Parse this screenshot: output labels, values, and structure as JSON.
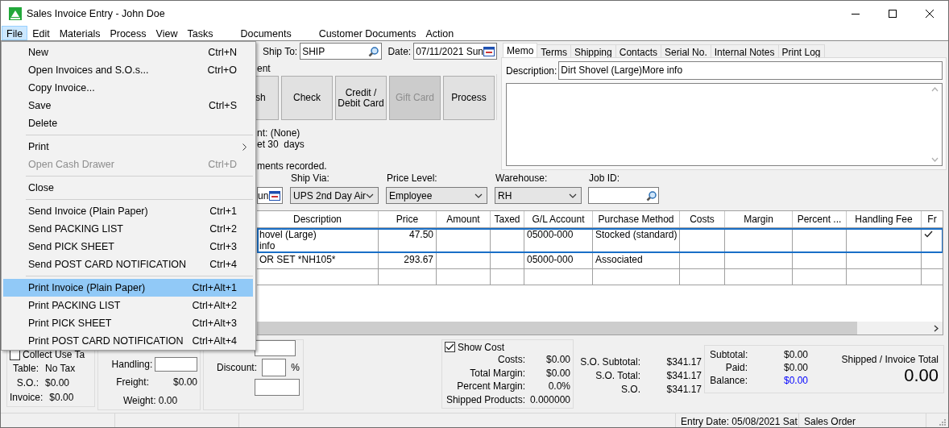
{
  "window": {
    "title": "Sales Invoice Entry - John Doe"
  },
  "menu_bar": [
    {
      "label": "File",
      "selected": true
    },
    {
      "label": "Edit",
      "selected": false
    },
    {
      "label": "Materials",
      "selected": false
    },
    {
      "label": "Process",
      "selected": false
    },
    {
      "label": "View",
      "selected": false
    },
    {
      "label": "Tasks",
      "selected": false
    },
    {
      "label": "Documents",
      "selected": false
    },
    {
      "label": "Customer Documents",
      "selected": false
    },
    {
      "label": "Action",
      "selected": false
    }
  ],
  "file_menu": [
    {
      "kind": "item",
      "label": "New",
      "shortcut": "Ctrl+N",
      "disabled": false,
      "selected": false
    },
    {
      "kind": "item",
      "label": "Open Invoices and S.O.s...",
      "shortcut": "Ctrl+O",
      "disabled": false,
      "selected": false
    },
    {
      "kind": "item",
      "label": "Copy Invoice...",
      "disabled": false,
      "selected": false
    },
    {
      "kind": "item",
      "label": "Save",
      "shortcut": "Ctrl+S",
      "disabled": false,
      "selected": false
    },
    {
      "kind": "item",
      "label": "Delete",
      "disabled": false,
      "selected": false
    },
    {
      "kind": "separator"
    },
    {
      "kind": "submenu",
      "label": "Print",
      "disabled": false,
      "selected": false
    },
    {
      "kind": "item",
      "label": "Open Cash Drawer",
      "shortcut": "Ctrl+D",
      "disabled": true,
      "selected": false
    },
    {
      "kind": "separator"
    },
    {
      "kind": "item",
      "label": "Close",
      "disabled": false,
      "selected": false
    },
    {
      "kind": "separator"
    },
    {
      "kind": "item",
      "label": "Send Invoice (Plain Paper)",
      "shortcut": "Ctrl+1",
      "disabled": false,
      "selected": false
    },
    {
      "kind": "item",
      "label": "Send PACKING LIST",
      "shortcut": "Ctrl+2",
      "disabled": false,
      "selected": false
    },
    {
      "kind": "item",
      "label": "Send PICK SHEET",
      "shortcut": "Ctrl+3",
      "disabled": false,
      "selected": false
    },
    {
      "kind": "item",
      "label": "Send POST CARD NOTIFICATION",
      "shortcut": "Ctrl+4",
      "disabled": false,
      "selected": false
    },
    {
      "kind": "separator"
    },
    {
      "kind": "item",
      "label": "Print Invoice (Plain Paper)",
      "shortcut": "Ctrl+Alt+1",
      "disabled": false,
      "selected": true
    },
    {
      "kind": "item",
      "label": "Print PACKING LIST",
      "shortcut": "Ctrl+Alt+2",
      "disabled": false,
      "selected": false
    },
    {
      "kind": "item",
      "label": "Print PICK SHEET",
      "shortcut": "Ctrl+Alt+3",
      "disabled": false,
      "selected": false
    },
    {
      "kind": "item",
      "label": "Print POST CARD NOTIFICATION",
      "shortcut": "Ctrl+Alt+4",
      "disabled": false,
      "selected": false
    }
  ],
  "ship_to": {
    "label": "Ship To:",
    "value": "SHIP"
  },
  "date": {
    "label": "Date:",
    "value": "07/11/2021 Sun"
  },
  "payment": {
    "label": "ent",
    "buttons": [
      {
        "label": "sh",
        "disabled": false
      },
      {
        "label": "Check",
        "disabled": false
      },
      {
        "label": "Credit /\nDebit Card",
        "disabled": false
      },
      {
        "label": "Gift Card",
        "disabled": true
      },
      {
        "label": "Process",
        "disabled": false
      }
    ],
    "info": [
      "nt: (None)",
      "et 30  days",
      "ments recorded."
    ]
  },
  "tabs": [
    {
      "label": "Memo",
      "selected": true
    },
    {
      "label": "Terms",
      "selected": false
    },
    {
      "label": "Shipping",
      "selected": false
    },
    {
      "label": "Contacts",
      "selected": false
    },
    {
      "label": "Serial No.",
      "selected": false
    },
    {
      "label": "Internal Notes",
      "selected": false
    },
    {
      "label": "Print Log",
      "selected": false
    }
  ],
  "memo": {
    "description_label": "Description:",
    "description": "Dirt Shovel (Large)More info"
  },
  "order_fields": [
    {
      "kind": "date",
      "value": "un"
    },
    {
      "kind": "select",
      "label": "Ship Via:",
      "value": "UPS 2nd Day Air"
    },
    {
      "kind": "select",
      "label": "Price Level:",
      "value": "Employee"
    },
    {
      "kind": "select",
      "label": "Warehouse:",
      "value": "RH"
    },
    {
      "kind": "lookup",
      "label": "Job ID:"
    }
  ],
  "table": {
    "columns": [
      "Description",
      "Price",
      "Amount",
      "Taxed",
      "G/L Account",
      "Purchase Method",
      "Costs",
      "Margin",
      "Percent ...",
      "Handling Fee",
      "Fr"
    ],
    "rows": [
      {
        "description": "hovel (Large)\ninfo",
        "price": "47.50",
        "gl_account": "05000-000",
        "purchase_method": "Stocked (standard)",
        "fr_checked": true,
        "selected": true
      },
      {
        "description": "OR SET *NH105*",
        "price": "293.67",
        "gl_account": "05000-000",
        "purchase_method": "Associated",
        "fr_checked": false,
        "selected": false
      }
    ]
  },
  "tax": {
    "collect_use_tax": {
      "label": "Collect Use Ta",
      "checked": false
    },
    "rows": [
      {
        "label": "Table:",
        "value": "No Tax"
      },
      {
        "label": "S.O.:",
        "value": "$0.00"
      },
      {
        "label": "Invoice:",
        "value": "$0.00"
      }
    ]
  },
  "shipping": {
    "handling_label": "Handling:",
    "freight_label": "Freight:",
    "freight": "$0.00",
    "weight": "Weight: 0.00"
  },
  "discount": {
    "label": "Discount:",
    "unit": "%"
  },
  "cost": {
    "show_cost": {
      "label": "Show Cost",
      "checked": true
    },
    "rows": [
      {
        "label": "Costs:",
        "value": "$0.00"
      },
      {
        "label": "Total Margin:",
        "value": "$0.00"
      },
      {
        "label": "Percent Margin:",
        "value": "0.0%"
      },
      {
        "label": "Shipped Products:",
        "value": "0.000000"
      }
    ]
  },
  "so_totals": [
    {
      "label": "S.O. Subtotal:",
      "value": "$341.17"
    },
    {
      "label": "S.O. Total:",
      "value": "$341.17"
    },
    {
      "label": "S.O.",
      "value": "$341.17"
    }
  ],
  "totals": {
    "rows": [
      {
        "label": "Subtotal:",
        "value": "$0.00",
        "color": "#000000"
      },
      {
        "label": "Paid:",
        "value": "$0.00",
        "color": "#000000"
      },
      {
        "label": "Balance:",
        "value": "$0.00",
        "color": "#0000ff"
      }
    ],
    "grand_label": "Shipped / Invoice Total",
    "grand_value": "0.00"
  },
  "status_bar": [
    "Entry Date: 05/08/2021 Sat",
    "Sales Order"
  ]
}
